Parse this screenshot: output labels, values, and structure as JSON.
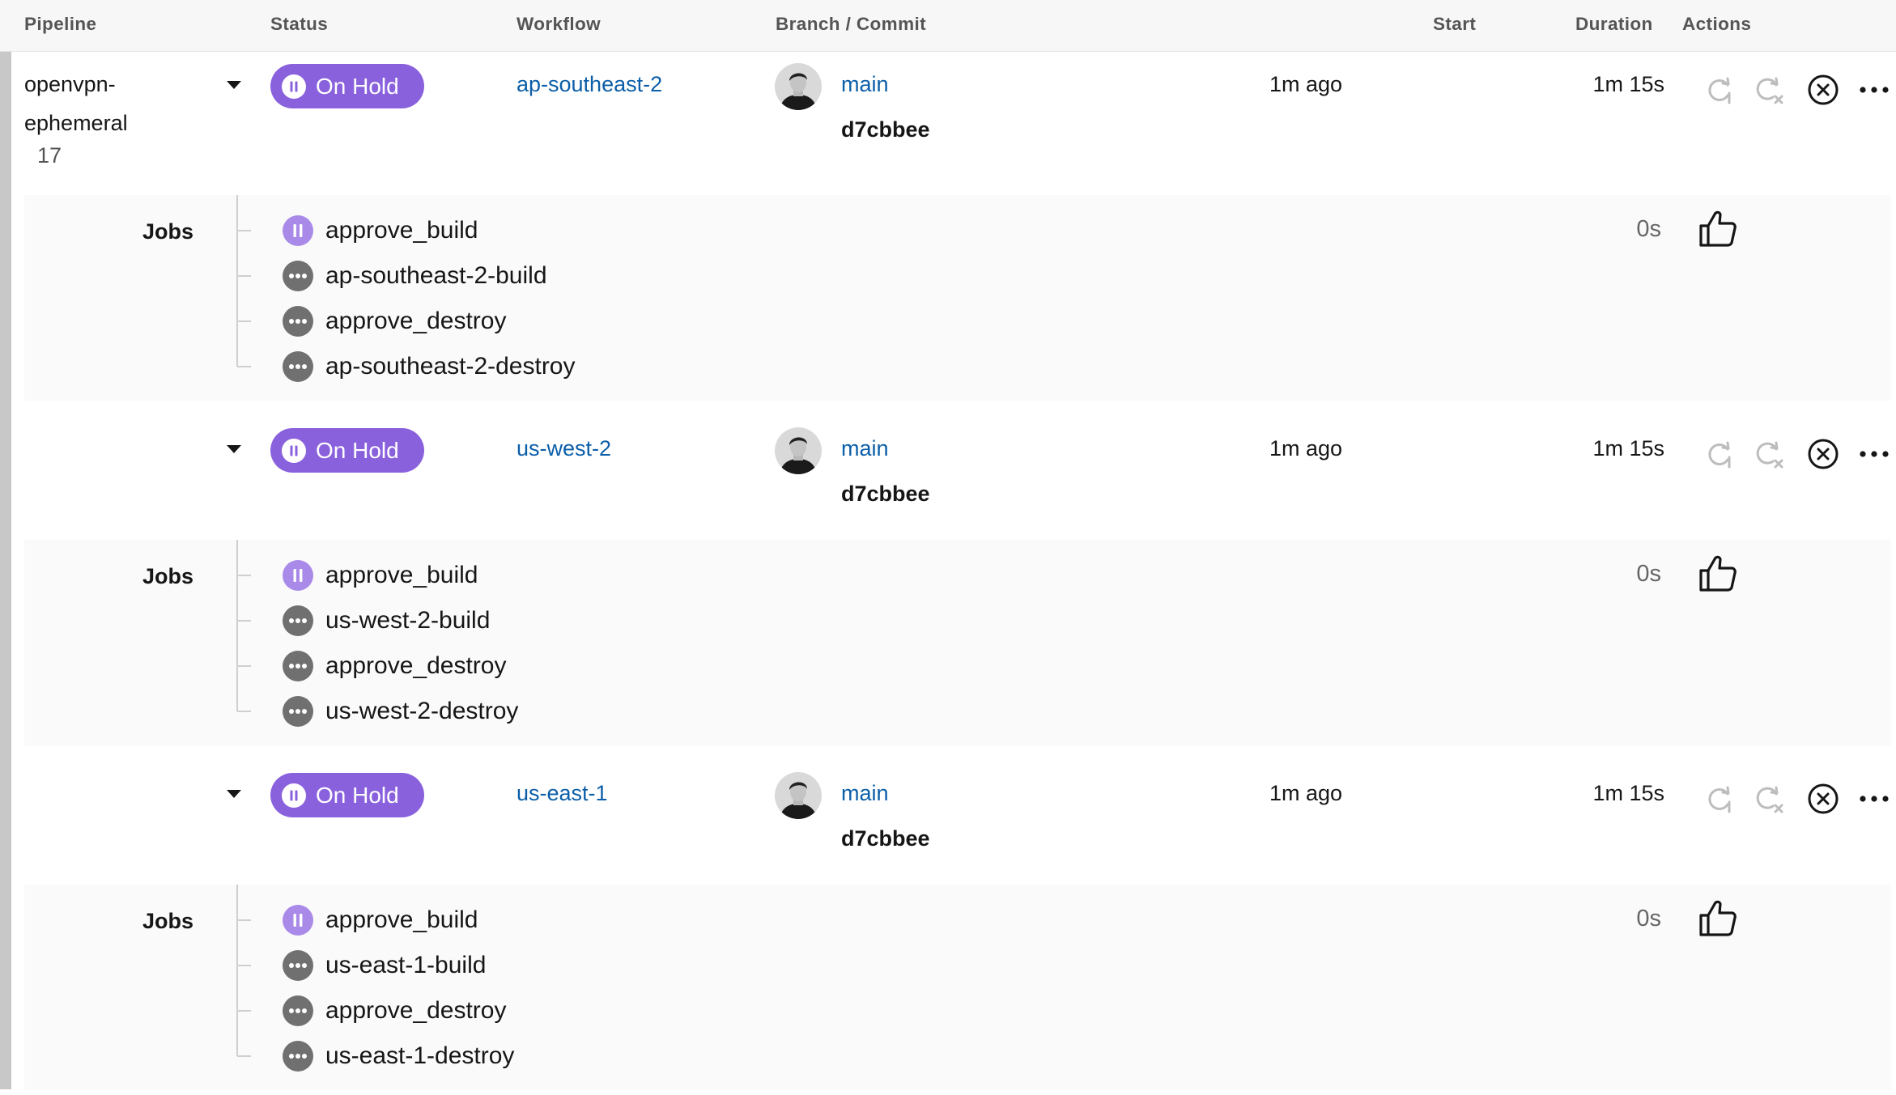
{
  "header": {
    "pipeline": "Pipeline",
    "status": "Status",
    "workflow": "Workflow",
    "branch_commit": "Branch / Commit",
    "start": "Start",
    "duration": "Duration",
    "actions": "Actions"
  },
  "pipeline": {
    "name_line1": "openvpn-",
    "name_line2": "ephemeral",
    "number": "17"
  },
  "colors": {
    "on_hold": "#8a61dd",
    "link": "#0b5ea8",
    "queued": "#707070"
  },
  "workflows": [
    {
      "status": "On Hold",
      "name": "ap-southeast-2",
      "branch": "main",
      "commit": "d7cbbee",
      "start": "1m ago",
      "duration": "1m 15s",
      "jobs_label": "Jobs",
      "job_duration": "0s",
      "jobs": [
        {
          "name": "approve_build",
          "icon": "pause-icon"
        },
        {
          "name": "ap-southeast-2-build",
          "icon": "queued-icon"
        },
        {
          "name": "approve_destroy",
          "icon": "queued-icon"
        },
        {
          "name": "ap-southeast-2-destroy",
          "icon": "queued-icon"
        }
      ]
    },
    {
      "status": "On Hold",
      "name": "us-west-2",
      "branch": "main",
      "commit": "d7cbbee",
      "start": "1m ago",
      "duration": "1m 15s",
      "jobs_label": "Jobs",
      "job_duration": "0s",
      "jobs": [
        {
          "name": "approve_build",
          "icon": "pause-icon"
        },
        {
          "name": "us-west-2-build",
          "icon": "queued-icon"
        },
        {
          "name": "approve_destroy",
          "icon": "queued-icon"
        },
        {
          "name": "us-west-2-destroy",
          "icon": "queued-icon"
        }
      ]
    },
    {
      "status": "On Hold",
      "name": "us-east-1",
      "branch": "main",
      "commit": "d7cbbee",
      "start": "1m ago",
      "duration": "1m 15s",
      "jobs_label": "Jobs",
      "job_duration": "0s",
      "jobs": [
        {
          "name": "approve_build",
          "icon": "pause-icon"
        },
        {
          "name": "us-east-1-build",
          "icon": "queued-icon"
        },
        {
          "name": "approve_destroy",
          "icon": "queued-icon"
        },
        {
          "name": "us-east-1-destroy",
          "icon": "queued-icon"
        }
      ]
    }
  ]
}
